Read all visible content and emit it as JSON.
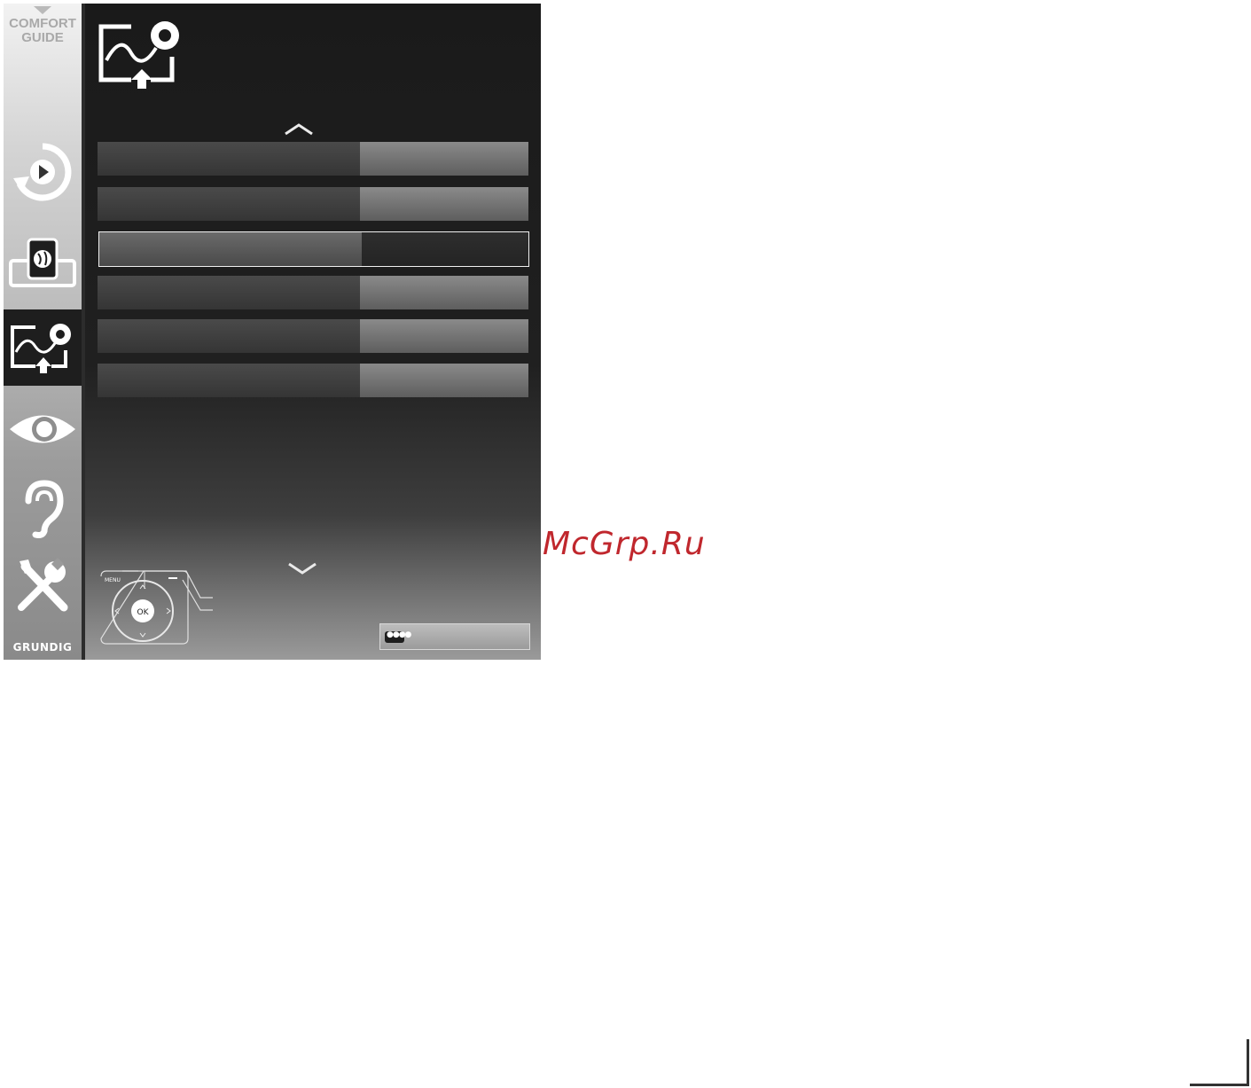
{
  "sidebar": {
    "guide_line1": "COMFORT",
    "guide_line2": "GUIDE",
    "brand": "GRUNDIG",
    "items": [
      {
        "icon": "playback-icon"
      },
      {
        "icon": "network-device-icon"
      },
      {
        "icon": "source-connection-icon",
        "active": true
      },
      {
        "icon": "eye-picture-icon"
      },
      {
        "icon": "ear-sound-icon"
      },
      {
        "icon": "tools-settings-icon"
      }
    ]
  },
  "header": {
    "icon": "source-connection-icon"
  },
  "menu": {
    "rows": [
      {
        "label": "",
        "value": ""
      },
      {
        "label": "",
        "value": ""
      },
      {
        "label": "",
        "value": "",
        "selected": true
      },
      {
        "label": "",
        "value": ""
      },
      {
        "label": "",
        "value": ""
      },
      {
        "label": "",
        "value": ""
      }
    ]
  },
  "remote": {
    "ok_label": "OK",
    "menu_label": "MENU"
  },
  "status": {
    "indicator": "●●●●"
  },
  "watermark": "McGrp.Ru",
  "colors": {
    "watermark": "#c0272d",
    "panel": "#1e1e1e",
    "sidebar": "#bdbdbd"
  }
}
